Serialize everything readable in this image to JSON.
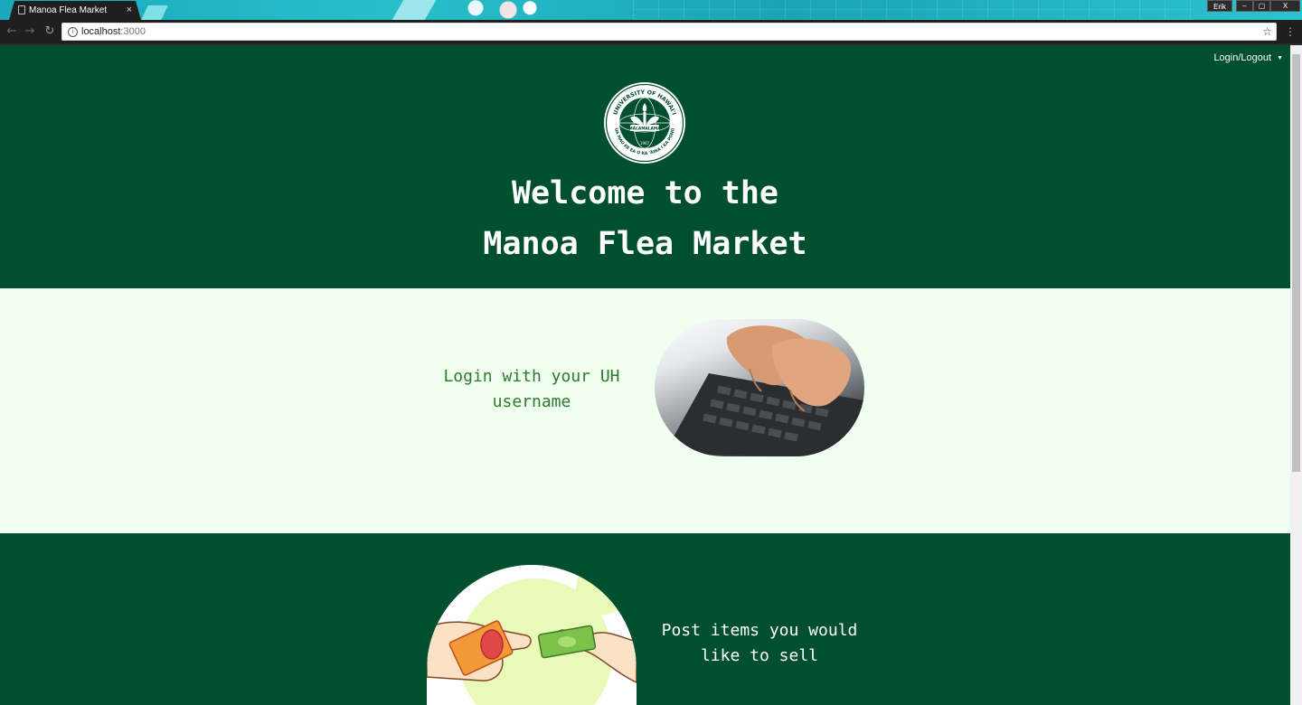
{
  "browser": {
    "tab_title": "Manoa Flea Market",
    "tab_close": "×",
    "user_label": "Erik",
    "minimize": "–",
    "maximize": "▢",
    "close": "X",
    "url_host": "localhost",
    "url_port": ":3000",
    "info_glyph": "i",
    "star_glyph": "☆",
    "menu_glyph": "⋮",
    "back_glyph": "←",
    "forward_glyph": "→",
    "reload_glyph": "↻"
  },
  "navbar": {
    "account_menu_label": "Login/Logout",
    "caret": "▼"
  },
  "hero": {
    "title_line1": "Welcome to the",
    "title_line2": "Manoa Flea Market",
    "seal_text_top": "UNIVERSITY OF HAWAI'I",
    "seal_text_bottom": "UA MAU KE EA O KA 'ĀINA I KA PONO",
    "seal_ribbon": "MĀLAMALAMA",
    "seal_year": "1907"
  },
  "sections": {
    "login_text": "Login with your UH username",
    "sell_text": "Post items you would like to sell"
  },
  "colors": {
    "brand_green": "#004f2f",
    "light_mint": "#f0fff0",
    "login_text_green": "#2d7a2d"
  }
}
